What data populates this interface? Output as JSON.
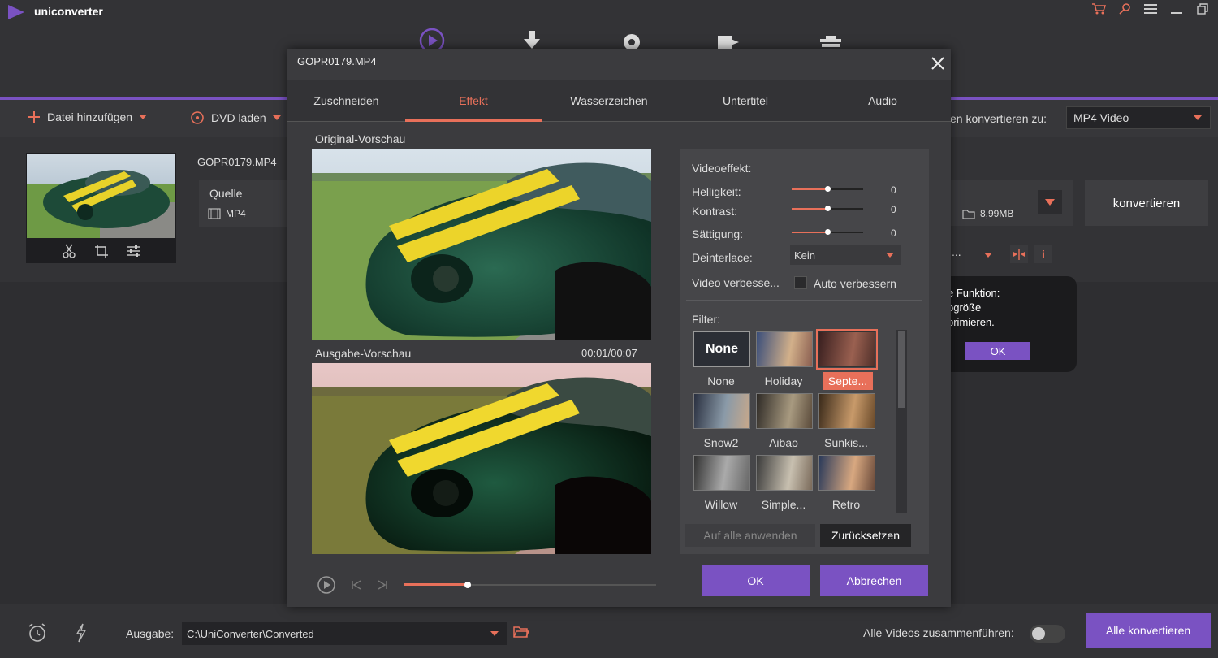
{
  "app": {
    "name": "uniconverter"
  },
  "toolbar": {
    "add_file": "Datei hinzufügen",
    "load_dvd": "DVD laden",
    "convert_to_label": "en konvertieren zu:",
    "convert_to_value": "MP4 Video"
  },
  "file": {
    "name": "GOPR0179.MP4",
    "source_label": "Quelle",
    "source_format": "MP4",
    "size": "8,99MB",
    "convert_button": "konvertieren",
    "more": "..."
  },
  "tooltip": {
    "line1": "e Funktion:",
    "line2": "ogröße",
    "line3": "primieren.",
    "ok": "OK"
  },
  "bottom": {
    "output_label": "Ausgabe:",
    "output_path": "C:\\UniConverter\\Converted",
    "merge_label": "Alle Videos zusammenführen:",
    "convert_all": "Alle konvertieren"
  },
  "dialog": {
    "title": "GOPR0179.MP4",
    "tabs": [
      "Zuschneiden",
      "Effekt",
      "Wasserzeichen",
      "Untertitel",
      "Audio"
    ],
    "active_tab": "Effekt",
    "original_preview": "Original-Vorschau",
    "output_preview": "Ausgabe-Vorschau",
    "timecode": "00:01/00:07",
    "playback_progress": 0.25,
    "effects": {
      "title": "Videoeffekt:",
      "brightness_label": "Helligkeit:",
      "brightness_value": "0",
      "contrast_label": "Kontrast:",
      "contrast_value": "0",
      "saturation_label": "Sättigung:",
      "saturation_value": "0",
      "deinterlace_label": "Deinterlace:",
      "deinterlace_value": "Kein",
      "enhance_label": "Video verbesse...",
      "auto_enhance_label": "Auto verbessern"
    },
    "filter_label": "Filter:",
    "filters": [
      "None",
      "Holiday",
      "Septe...",
      "Snow2",
      "Aibao",
      "Sunkis...",
      "Willow",
      "Simple...",
      "Retro"
    ],
    "selected_filter": "Septe...",
    "none_thumb_text": "None",
    "apply_all": "Auf alle anwenden",
    "reset": "Zurücksetzen",
    "ok": "OK",
    "cancel": "Abbrechen"
  },
  "colors": {
    "accent": "#7a52c2",
    "highlight": "#e8705a"
  }
}
